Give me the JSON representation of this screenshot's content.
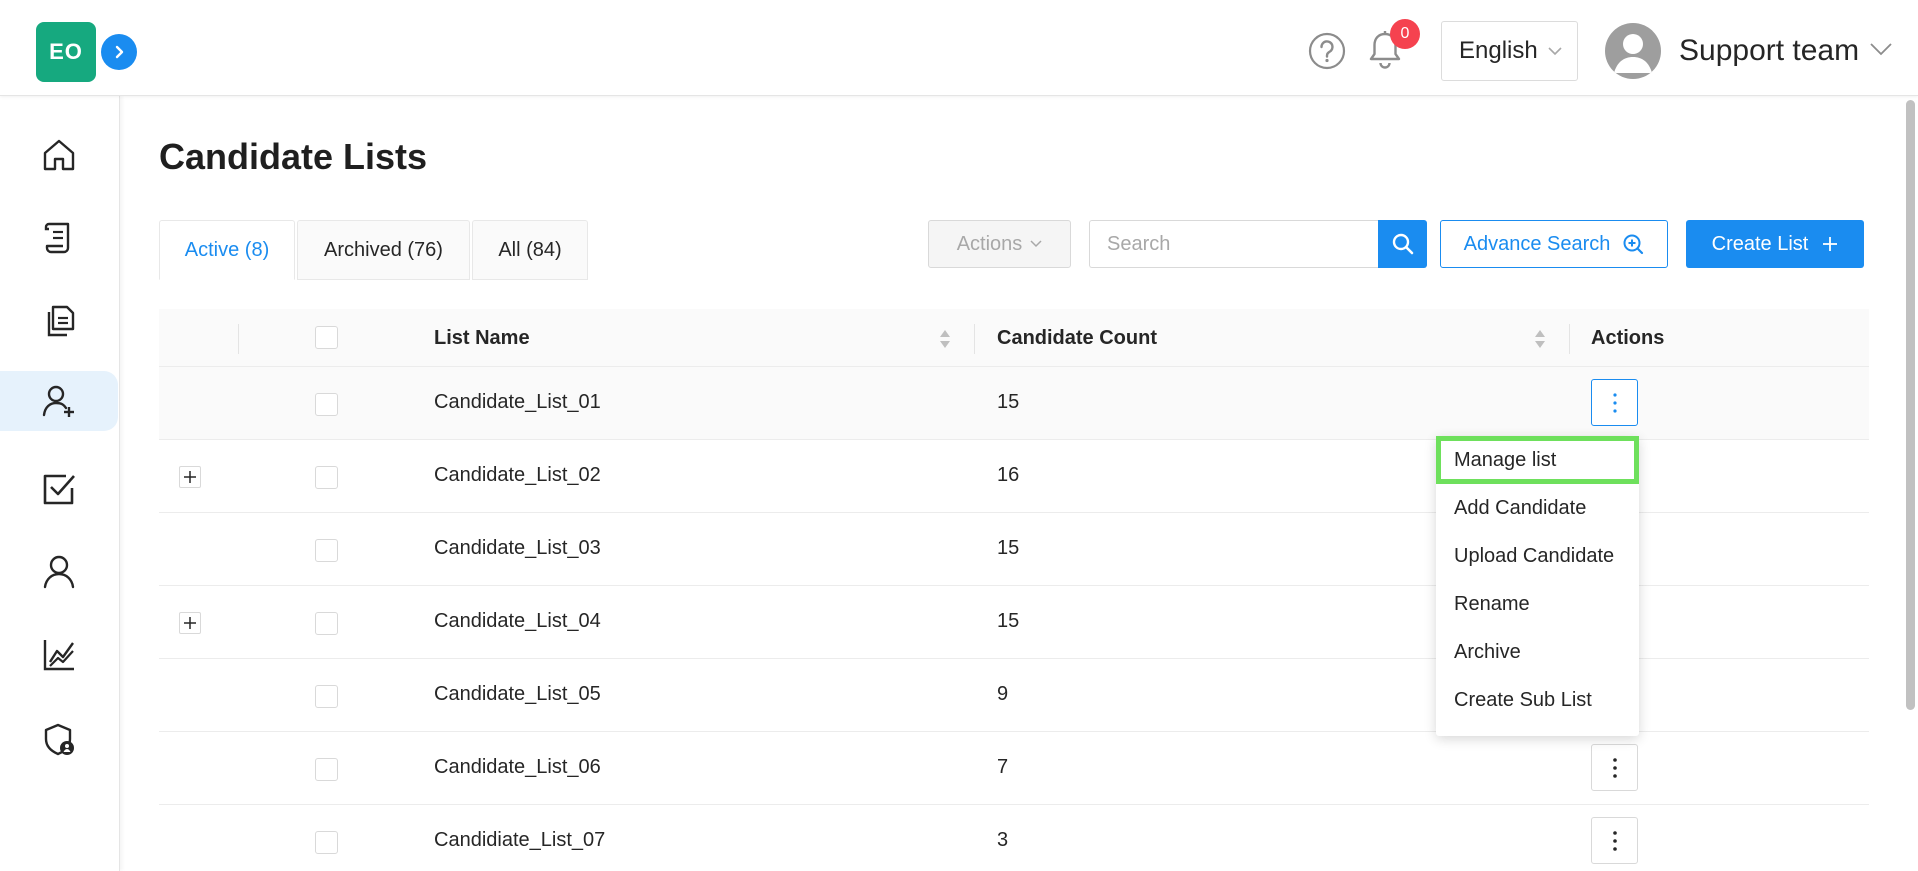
{
  "header": {
    "logo_text": "EO",
    "notification_count": "0",
    "language": "English",
    "user_name": "Support team"
  },
  "sidebar": {
    "items": [
      {
        "icon": "home-icon"
      },
      {
        "icon": "scroll-icon"
      },
      {
        "icon": "documents-icon"
      },
      {
        "icon": "add-user-icon",
        "active": true
      },
      {
        "icon": "checkbox-icon"
      },
      {
        "icon": "user-icon"
      },
      {
        "icon": "chart-icon"
      },
      {
        "icon": "shield-user-icon"
      }
    ]
  },
  "page": {
    "title": "Candidate Lists"
  },
  "tabs": [
    {
      "label": "Active (8)",
      "active": true
    },
    {
      "label": "Archived (76)"
    },
    {
      "label": "All (84)"
    }
  ],
  "toolbar": {
    "actions_label": "Actions",
    "search_placeholder": "Search",
    "advance_search_label": "Advance Search",
    "create_list_label": "Create List"
  },
  "table": {
    "columns": [
      "List Name",
      "Candidate Count",
      "Actions"
    ],
    "rows": [
      {
        "name": "Candidate_List_01",
        "count": "15",
        "expandable": false
      },
      {
        "name": "Candidate_List_02",
        "count": "16",
        "expandable": true
      },
      {
        "name": "Candidate_List_03",
        "count": "15",
        "expandable": false
      },
      {
        "name": "Candidate_List_04",
        "count": "15",
        "expandable": true
      },
      {
        "name": "Candidate_List_05",
        "count": "9",
        "expandable": false
      },
      {
        "name": "Candidate_List_06",
        "count": "7",
        "expandable": false
      },
      {
        "name": "Candidiate_List_07",
        "count": "3",
        "expandable": false
      }
    ]
  },
  "dropdown": {
    "items": [
      "Manage list",
      "Add Candidate",
      "Upload Candidate",
      "Rename",
      "Archive",
      "Create Sub List"
    ]
  },
  "colors": {
    "primary": "#1a8cf0",
    "logo": "#16a97f",
    "badge": "#f5424f",
    "focus_outline": "#6ee05c"
  }
}
